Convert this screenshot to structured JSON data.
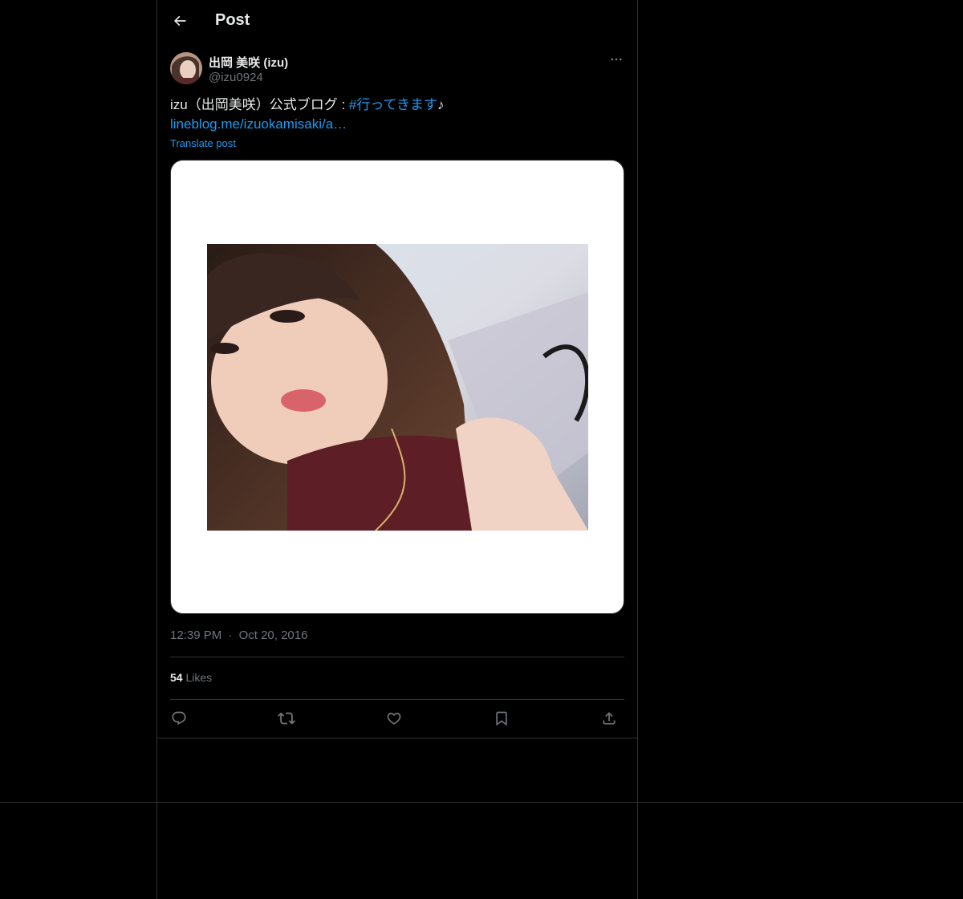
{
  "header": {
    "title": "Post",
    "back_icon": "arrow-left-icon"
  },
  "author": {
    "display_name": "出岡 美咲 (izu)",
    "handle": "@izu0924",
    "more_icon": "more-horizontal-icon"
  },
  "post": {
    "text_prefix": "izu（出岡美咲）公式ブログ : ",
    "hashtag": "#行ってきます",
    "text_suffix": "♪",
    "link": "lineblog.me/izuokamisaki/a…",
    "translate_label": "Translate post"
  },
  "meta": {
    "time": "12:39 PM",
    "separator": "·",
    "date": "Oct 20, 2016"
  },
  "stats": {
    "likes_count": "54",
    "likes_label": "Likes"
  },
  "actions": [
    {
      "icon": "reply-icon"
    },
    {
      "icon": "repost-icon"
    },
    {
      "icon": "like-icon"
    },
    {
      "icon": "bookmark-icon"
    },
    {
      "icon": "share-icon"
    }
  ],
  "colors": {
    "background": "#000000",
    "text": "#e7e9ea",
    "muted": "#71767b",
    "accent": "#1d9bf0",
    "border": "#2f3336"
  }
}
